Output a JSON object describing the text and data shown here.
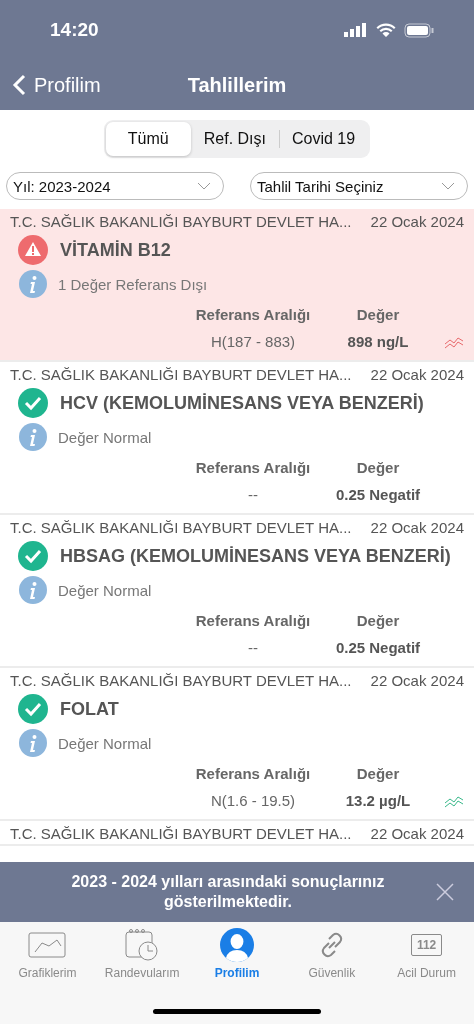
{
  "status_bar": {
    "time": "14:20"
  },
  "nav": {
    "back": "Profilim",
    "title": "Tahlillerim"
  },
  "segments": [
    {
      "label": "Tümü",
      "selected": true
    },
    {
      "label": "Ref. Dışı",
      "selected": false
    },
    {
      "label": "Covid 19",
      "selected": false
    }
  ],
  "filters": [
    {
      "value": "Yıl: 2023-2024"
    },
    {
      "value": "Tahlil Tarihi Seçiniz"
    }
  ],
  "results": [
    {
      "institution": "T.C. SAĞLIK BAKANLIĞI BAYBURT DEVLET HA...",
      "date": "22 Ocak 2024",
      "kind": "abnormal",
      "title": "VİTAMİN B12",
      "info": "1 Değer Referans Dışı",
      "ref_header": "Referans Aralığı",
      "value_header": "Değer",
      "range": "H(187 - 883)",
      "value": "898 ng/L",
      "trend": true
    },
    {
      "institution": "T.C. SAĞLIK BAKANLIĞI BAYBURT DEVLET HA...",
      "date": "22 Ocak 2024",
      "kind": "normal",
      "title": "HCV (KEMOLUMİNESANS VEYA BENZERİ)",
      "info": "Değer Normal",
      "ref_header": "Referans Aralığı",
      "value_header": "Değer",
      "range": "--",
      "value": "0.25  Negatif",
      "trend": false
    },
    {
      "institution": "T.C. SAĞLIK BAKANLIĞI BAYBURT DEVLET HA...",
      "date": "22 Ocak 2024",
      "kind": "normal",
      "title": "HBSAG (KEMOLUMİNESANS VEYA BENZERİ)",
      "info": "Değer Normal",
      "ref_header": "Referans Aralığı",
      "value_header": "Değer",
      "range": "--",
      "value": "0.25  Negatif",
      "trend": false
    },
    {
      "institution": "T.C. SAĞLIK BAKANLIĞI BAYBURT DEVLET HA...",
      "date": "22 Ocak 2024",
      "kind": "normal",
      "title": "FOLAT",
      "info": "Değer Normal",
      "ref_header": "Referans Aralığı",
      "value_header": "Değer",
      "range": "N(1.6 - 19.5)",
      "value": "13.2 µg/L",
      "trend": true
    },
    {
      "institution": "T.C. SAĞLIK BAKANLIĞI BAYBURT DEVLET HA...",
      "date": "22 Ocak 2024",
      "kind": "partial"
    }
  ],
  "toast": {
    "message": "2023 - 2024 yılları arasındaki sonuçlarınız gösterilmektedir."
  },
  "tabs": [
    {
      "label": "Grafiklerim",
      "kind": "chart",
      "selected": false
    },
    {
      "label": "Randevularım",
      "kind": "calendar",
      "selected": false
    },
    {
      "label": "Profilim",
      "kind": "person",
      "selected": true
    },
    {
      "label": "Güvenlik",
      "kind": "link",
      "selected": false
    },
    {
      "label": "Acil Durum",
      "kind": "emergency",
      "badge": "112",
      "selected": false
    }
  ]
}
